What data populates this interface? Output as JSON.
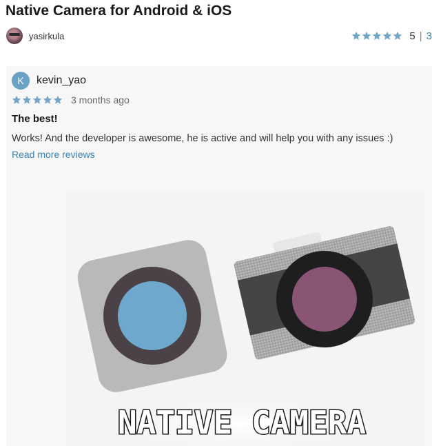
{
  "page": {
    "title": "Native Camera for Android & iOS",
    "author": "yasirkula",
    "rating": {
      "value": "5",
      "separator": "|",
      "count": "3",
      "stars": 5,
      "color": "#72a5c6"
    }
  },
  "review": {
    "avatar_letter": "K",
    "reviewer": "kevin_yao",
    "stars": 5,
    "date": "3 months ago",
    "title": "The best!",
    "body": "Works! And the developer is awesome, he is active and will help you with any issues :)",
    "read_more": "Read more reviews"
  },
  "promo": {
    "caption": "NATIVE CAMERA",
    "icons": [
      "front-camera-icon",
      "back-camera-icon"
    ],
    "colors": {
      "lens_blue": "#6ea9cd",
      "lens_purple": "#8a5474",
      "body_gray": "#b9b9b9"
    }
  }
}
